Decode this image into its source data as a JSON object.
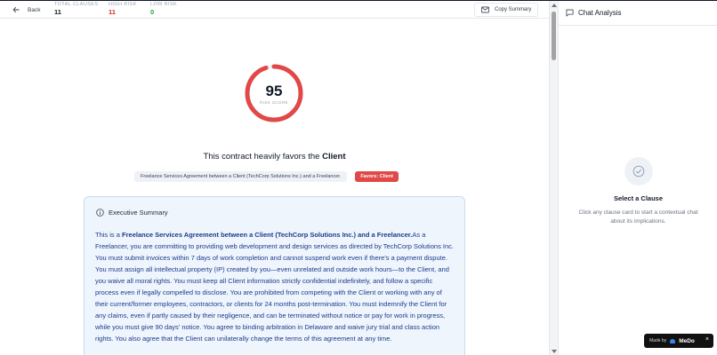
{
  "header": {
    "back_label": "Back",
    "stats": [
      {
        "label": "TOTAL CLAUSES",
        "value": "11",
        "color": "#111827"
      },
      {
        "label": "HIGH RISK",
        "value": "11",
        "color": "#dc2626"
      },
      {
        "label": "LOW RISK",
        "value": "0",
        "color": "#16a34a"
      }
    ],
    "copy_label": "Copy Summary"
  },
  "score": {
    "value": "95",
    "label": "RISK SCORE",
    "fraction": 0.95,
    "color": "#e14848"
  },
  "verdict": {
    "prefix": "This contract heavily favors the",
    "party": "Client"
  },
  "tags": {
    "title": "Freelance Services Agreement between a Client (TechCorp Solutions Inc.) and a Freelancer.",
    "favors": "Favors: Client"
  },
  "summary": {
    "heading": "Executive Summary",
    "lead": "This is a",
    "lead_bold": "Freelance Services Agreement between a Client (TechCorp Solutions Inc.) and a Freelancer.",
    "body": "As a Freelancer, you are committing to providing web development and design services as directed by TechCorp Solutions Inc. You must submit invoices within 7 days of work completion and cannot suspend work even if there's a payment dispute. You must assign all intellectual property (IP) created by you—even unrelated and outside work hours—to the Client, and you waive all moral rights. You must keep all Client information strictly confidential indefinitely, and follow a specific process even if legally compelled to disclose. You are prohibited from competing with the Client or working with any of their current/former employees, contractors, or clients for 24 months post-termination. You must indemnify the Client for any claims, even if partly caused by their negligence, and can be terminated without notice or pay for work in progress, while you must give 90 days' notice. You agree to binding arbitration in Delaware and waive jury trial and class action rights. You also agree that the Client can unilaterally change the terms of this agreement at any time."
  },
  "chat": {
    "title": "Chat Analysis",
    "empty_title": "Select a Clause",
    "empty_text": "Click any clause card to start a contextual chat about its implications."
  },
  "badge": {
    "made_by": "Made by",
    "brand": "MeDo",
    "close": "×"
  }
}
